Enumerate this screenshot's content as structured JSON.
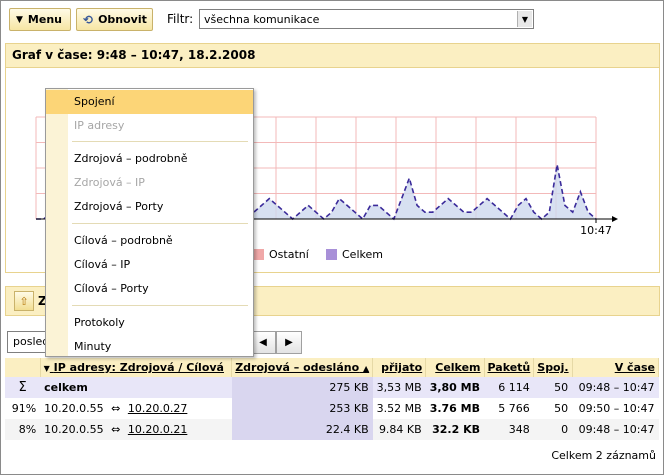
{
  "toolbar": {
    "menu_label": "Menu",
    "refresh_label": "Obnovit",
    "filter_label": "Filtr:",
    "filter_value": "všechna komunikace"
  },
  "graph": {
    "title": "Graf v čase: 9:48 – 10:47, 18.2.2008",
    "time_label": "10:47",
    "legend": [
      {
        "label": "Ostatní",
        "color": "#f0a0a0"
      },
      {
        "label": "Celkem",
        "color": "#a890d8"
      }
    ]
  },
  "chart_data": {
    "type": "area",
    "x_end_label": "10:47",
    "series": [
      {
        "name": "Celkem",
        "values": [
          0,
          0,
          1,
          0,
          1,
          0,
          0,
          2,
          1,
          0,
          0,
          1,
          0,
          0,
          1,
          2,
          1,
          5,
          3,
          2,
          14,
          5,
          2,
          1,
          1,
          2,
          1,
          0,
          1,
          2,
          3,
          2,
          1,
          0,
          1,
          2,
          1,
          0,
          1,
          3,
          2,
          1,
          0,
          2,
          2,
          1,
          0,
          3,
          6,
          2,
          1,
          1,
          2,
          3,
          2,
          1,
          1,
          2,
          3,
          2,
          1,
          0,
          2,
          3,
          1,
          0,
          1,
          8,
          2,
          1,
          4,
          1,
          0
        ]
      }
    ],
    "grid": true
  },
  "section2": {
    "label": "Zp"
  },
  "controls": {
    "input_value": "poslední hodina"
  },
  "table": {
    "headers": {
      "ip": "IP adresy: Zdrojová / Cílová",
      "sent": "Zdrojová – odesláno",
      "received": "přijato",
      "total": "Celkem",
      "packets": "Paketů",
      "conns": "Spoj.",
      "time": "V čase"
    },
    "sum_row": {
      "icon": "Σ",
      "label": "celkem",
      "sent": "275 KB",
      "received": "3,53 MB",
      "total": "3,80 MB",
      "packets": "6 114",
      "conns": "50",
      "time": "09:48 – 10:47"
    },
    "rows": [
      {
        "pct": "91%",
        "src": "10.20.0.55",
        "arrow": "⇔",
        "dst": "10.20.0.27",
        "sent": "253 KB",
        "received": "3.52 MB",
        "total": "3.76 MB",
        "packets": "5 766",
        "conns": "50",
        "time": "09:50 – 10:47"
      },
      {
        "pct": "8%",
        "src": "10.20.0.55",
        "arrow": "⇔",
        "dst": "10.20.0.21",
        "sent": "22.4 KB",
        "received": "9.84 KB",
        "total": "32.2 KB",
        "packets": "348",
        "conns": "0",
        "time": "09:48 – 10:47"
      }
    ],
    "footer": "Celkem 2 záznamů"
  },
  "menu": {
    "items": [
      {
        "label": "Spojení",
        "state": "highlighted"
      },
      {
        "label": "IP adresy",
        "state": "disabled"
      },
      {
        "label": "Zdrojová – podrobně",
        "state": "enabled"
      },
      {
        "label": "Zdrojová – IP",
        "state": "disabled"
      },
      {
        "label": "Zdrojová – Porty",
        "state": "enabled"
      },
      {
        "label": "Cílová – podrobně",
        "state": "enabled"
      },
      {
        "label": "Cílová – IP",
        "state": "enabled"
      },
      {
        "label": "Cílová – Porty",
        "state": "enabled"
      },
      {
        "label": "Protokoly",
        "state": "enabled"
      },
      {
        "label": "Minuty",
        "state": "enabled"
      }
    ]
  }
}
